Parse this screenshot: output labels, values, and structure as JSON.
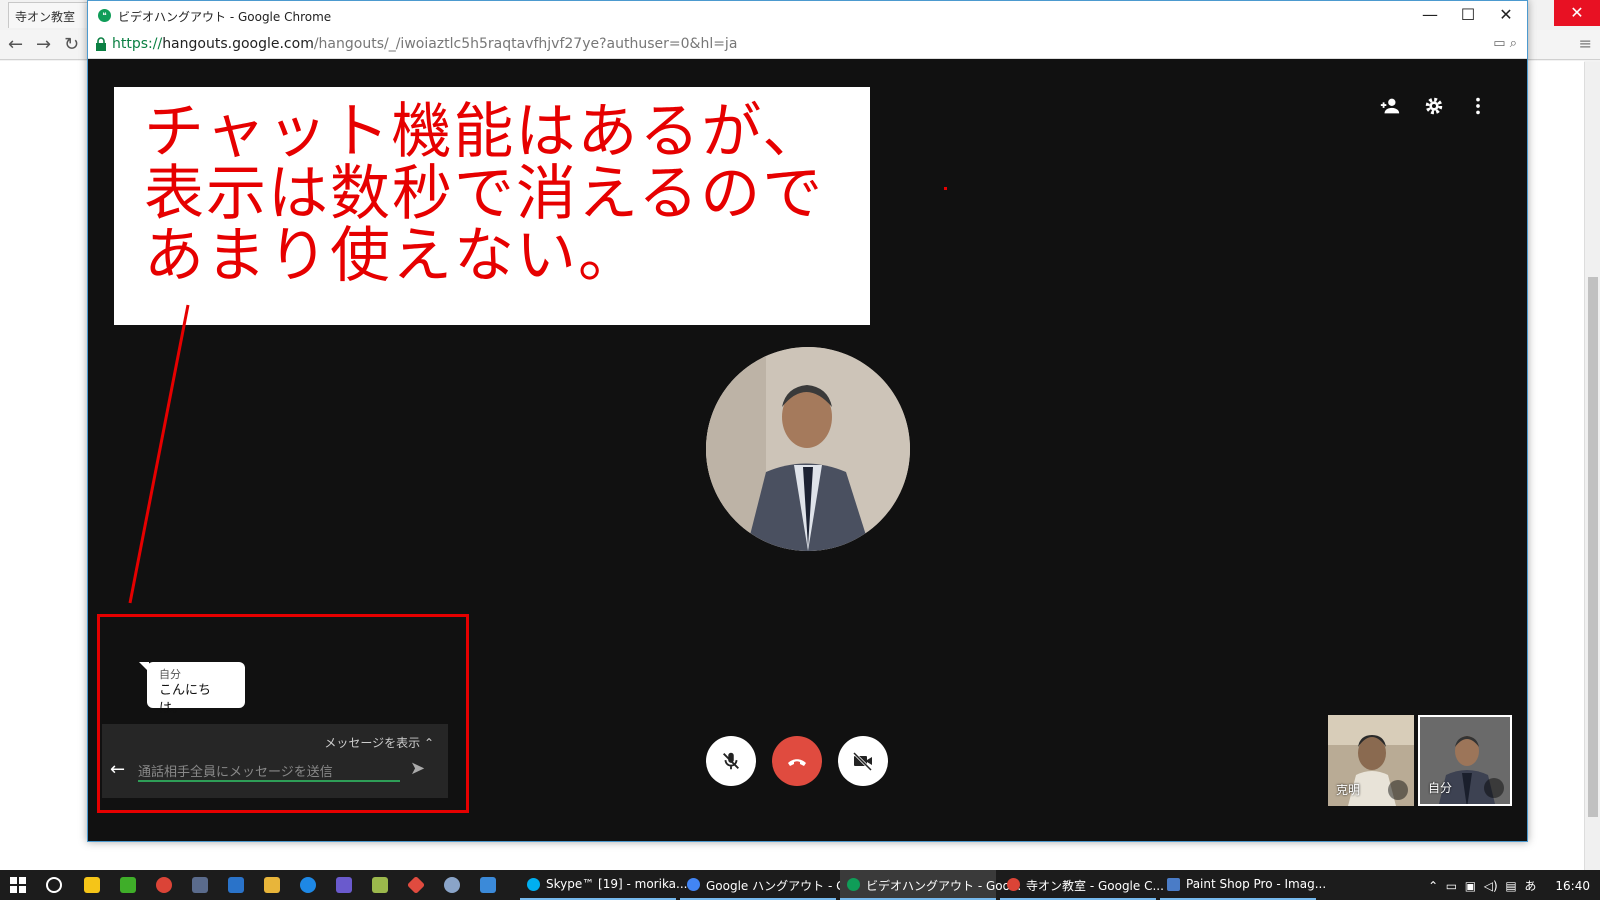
{
  "background_browser": {
    "tab_title": "寺オン教室",
    "page_text_fragment": ""
  },
  "popup_window": {
    "title": "ビデオハングアウト - Google Chrome",
    "url_scheme": "https://",
    "url_host": "hangouts.google.com",
    "url_path": "/hangouts/_/iwoiaztlc5h5raqtavfhjvf27ye?authuser=0&hl=ja"
  },
  "annotation": {
    "lines": [
      "チャット機能はあるが、",
      "表示は数秒で消えるので",
      "あまり使えない。"
    ]
  },
  "chat": {
    "bubble_sender": "自分",
    "bubble_message": "こんにちは。",
    "show_messages_label": "メッセージを表示",
    "input_placeholder": "通話相手全員にメッセージを送信"
  },
  "participants": [
    {
      "name": "克明"
    },
    {
      "name": "自分"
    }
  ],
  "taskbar": {
    "apps": [
      {
        "label": "Skype™ [19] - morika...",
        "color": "#00aff0"
      },
      {
        "label": "Google ハングアウト - G...",
        "color": "#4285f4"
      },
      {
        "label": "ビデオハングアウト - Goo...",
        "color": "#0f9d58"
      },
      {
        "label": "寺オン教室 - Google C...",
        "color": "#db4437"
      },
      {
        "label": "Paint Shop Pro - Imag...",
        "color": "#4a7cc7"
      }
    ],
    "tray_ime": "あ",
    "clock": "16:40"
  },
  "colors": {
    "annotation_red": "#e60000",
    "hangouts_green": "#0f9d58",
    "hangup_red": "#e04b3f"
  },
  "icons": [
    "add-person-icon",
    "gear-icon",
    "more-vert-icon",
    "mic-off-icon",
    "hangup-icon",
    "video-off-icon",
    "back-arrow-icon",
    "send-icon",
    "lock-icon"
  ]
}
